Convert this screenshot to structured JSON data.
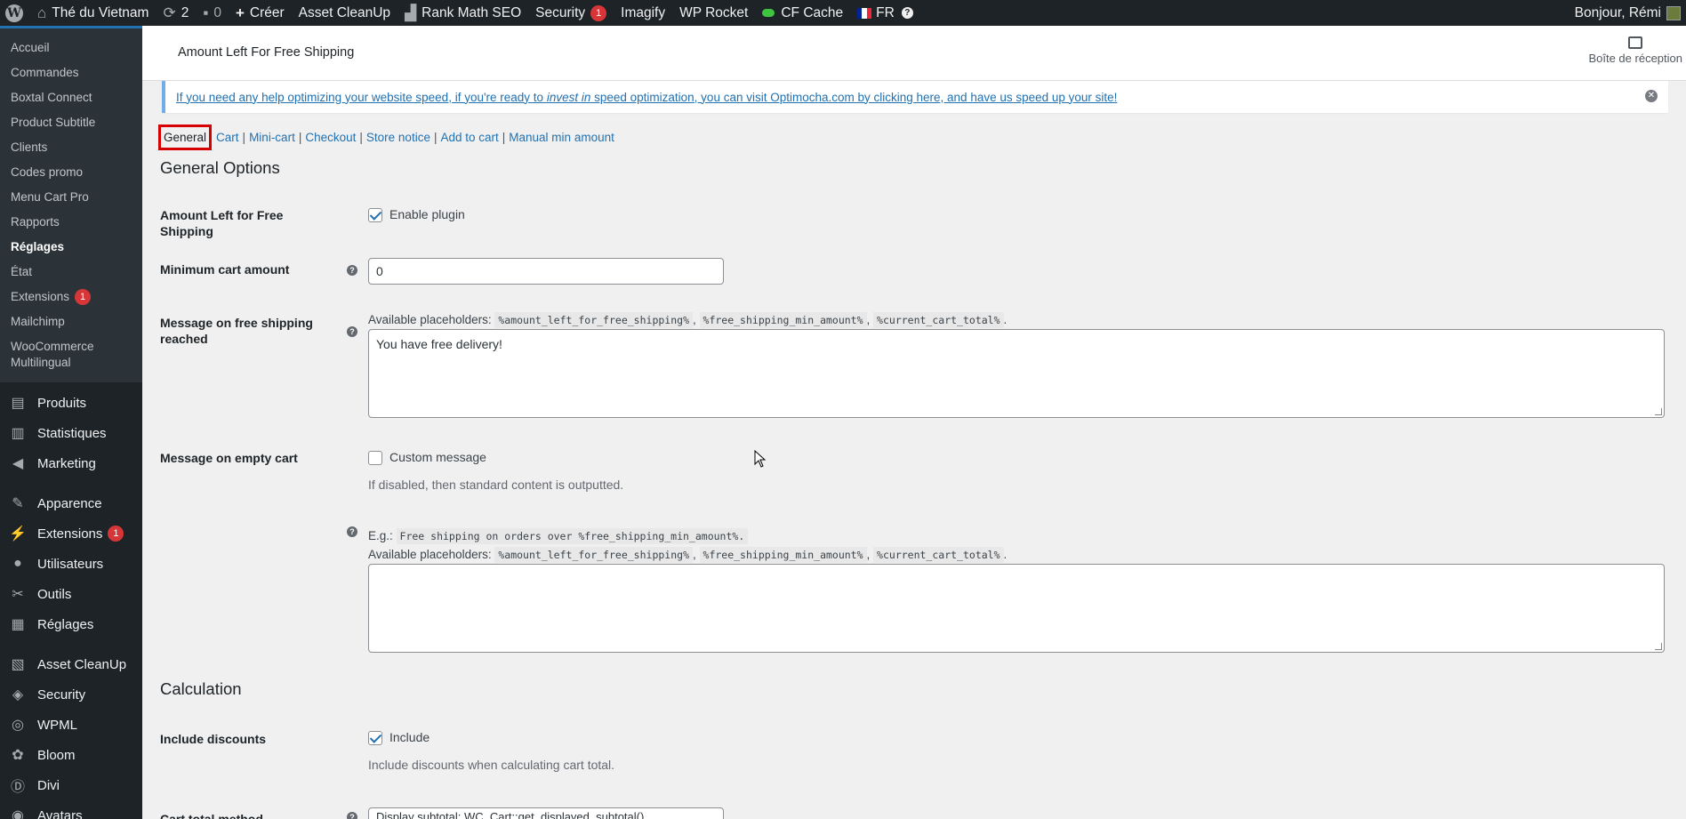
{
  "adminbar": {
    "site_name": "Thé du Vietnam",
    "updates_count": "2",
    "comments_count": "0",
    "new_label": "Créer",
    "items": [
      "Asset CleanUp",
      "Rank Math SEO"
    ],
    "security_label": "Security",
    "security_badge": "1",
    "imagify_label": "Imagify",
    "wprocket_label": "WP Rocket",
    "cfcache_label": "CF Cache",
    "lang_label": "FR",
    "help_label": "?",
    "greeting": "Bonjour, Rémi"
  },
  "sidebar": {
    "submenu": [
      {
        "label": "Accueil"
      },
      {
        "label": "Commandes"
      },
      {
        "label": "Boxtal Connect"
      },
      {
        "label": "Product Subtitle"
      },
      {
        "label": "Clients"
      },
      {
        "label": "Codes promo"
      },
      {
        "label": "Menu Cart Pro"
      },
      {
        "label": "Rapports"
      },
      {
        "label": "Réglages"
      },
      {
        "label": "État"
      },
      {
        "label": "Extensions",
        "badge": "1"
      },
      {
        "label": "Mailchimp"
      },
      {
        "label": "WooCommerce Multilingual"
      }
    ],
    "menu": [
      {
        "label": "Produits",
        "icon": "archive-icon"
      },
      {
        "label": "Statistiques",
        "icon": "bar-chart-icon"
      },
      {
        "label": "Marketing",
        "icon": "megaphone-icon"
      },
      {
        "label": "Apparence",
        "icon": "paintbrush-icon"
      },
      {
        "label": "Extensions",
        "icon": "plugin-icon",
        "badge": "1"
      },
      {
        "label": "Utilisateurs",
        "icon": "user-icon"
      },
      {
        "label": "Outils",
        "icon": "wrench-icon"
      },
      {
        "label": "Réglages",
        "icon": "settings-icon"
      },
      {
        "label": "Asset CleanUp",
        "icon": "cleanup-icon"
      },
      {
        "label": "Security",
        "icon": "shield-icon"
      },
      {
        "label": "WPML",
        "icon": "wpml-icon"
      },
      {
        "label": "Bloom",
        "icon": "bloom-icon"
      },
      {
        "label": "Divi",
        "icon": "divi-icon"
      },
      {
        "label": "Avatars",
        "icon": "avatar-icon"
      }
    ]
  },
  "header": {
    "title": "Amount Left For Free Shipping",
    "inbox_label": "Boîte de réception"
  },
  "notice": {
    "part1": "If you need any help optimizing your website speed, if you're ready to ",
    "part2": "invest in",
    "part3": " speed optimization, you can visit Optimocha.com by clicking here, and have us speed up your site!"
  },
  "tabs": [
    "General",
    "Cart",
    "Mini-cart",
    "Checkout",
    "Store notice",
    "Add to cart",
    "Manual min amount"
  ],
  "general": {
    "section_title": "General Options",
    "plugin_label": "Amount Left for Free Shipping",
    "enable_label": "Enable plugin",
    "min_cart_label": "Minimum cart amount",
    "min_cart_value": "0",
    "msg_reached_label": "Message on free shipping reached",
    "placeholders_prefix": "Available placeholders:",
    "placeholder_codes": [
      "%amount_left_for_free_shipping%",
      "%free_shipping_min_amount%",
      "%current_cart_total%"
    ],
    "msg_reached_value": "You have free delivery!",
    "empty_cart_label": "Message on empty cart",
    "custom_message_label": "Custom message",
    "empty_cart_desc": "If disabled, then standard content is outputted.",
    "example_prefix": "E.g.:",
    "example_code": "Free shipping on orders over %free_shipping_min_amount%.",
    "empty_cart_value": ""
  },
  "calculation": {
    "section_title": "Calculation",
    "include_discounts_label": "Include discounts",
    "include_label": "Include",
    "include_desc": "Include discounts when calculating cart total.",
    "cart_total_label": "Cart total method",
    "cart_total_value": "Display subtotal: WC_Cart::get_displayed_subtotal()"
  },
  "colors": {
    "accent": "#2271b1",
    "admin_bg": "#1d2327",
    "badge": "#d63638",
    "highlight_box": "#d60000"
  }
}
